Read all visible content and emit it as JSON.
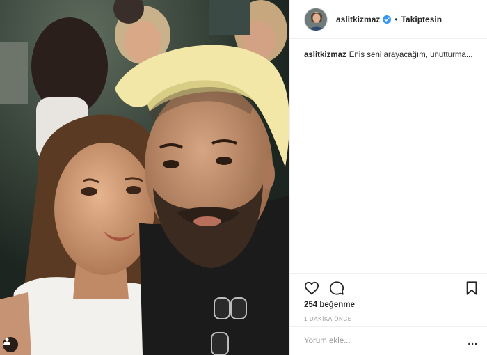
{
  "post": {
    "username": "aslitkizmaz",
    "follow_state": "Takiptesin",
    "separator": "•",
    "caption": {
      "username": "aslitkizmaz",
      "text": "Enis seni arayacağım, unutturma..."
    },
    "likes": "254 beğenme",
    "timestamp": "1 DAKİKA ÖNCE",
    "comment_placeholder": "Yorum ekle...",
    "more_label": "..."
  },
  "icons": [
    "heart-icon",
    "comment-icon",
    "bookmark-icon",
    "verified-badge-icon",
    "user-tag-icon"
  ],
  "colors": {
    "text": "#262626",
    "muted": "#999999",
    "verified": "#3897f0",
    "divider": "#efefef"
  }
}
